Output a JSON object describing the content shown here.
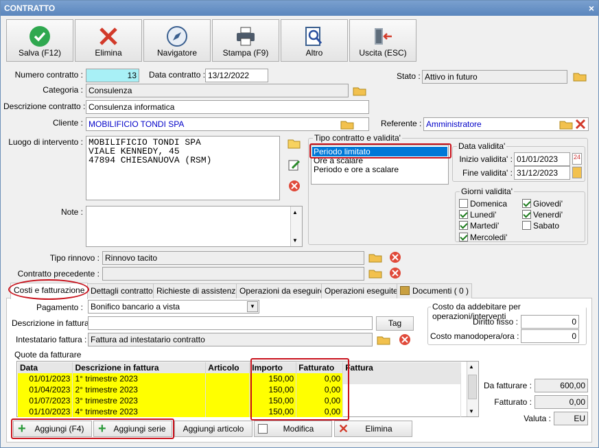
{
  "window": {
    "title": "CONTRATTO",
    "close": "×"
  },
  "toolbar": {
    "save": "Salva (F12)",
    "delete": "Elimina",
    "navigator": "Navigatore",
    "print": "Stampa (F9)",
    "other": "Altro",
    "exit": "Uscita (ESC)"
  },
  "form": {
    "numero_label": "Numero contratto :",
    "numero": "13",
    "data_label": "Data contratto :",
    "data": "13/12/2022",
    "stato_label": "Stato :",
    "stato": "Attivo in futuro",
    "categoria_label": "Categoria :",
    "categoria": "Consulenza",
    "descrizione_label": "Descrizione contratto :",
    "descrizione": "Consulenza informatica",
    "cliente_label": "Cliente :",
    "cliente": "MOBILIFICIO TONDI SPA",
    "referente_label": "Referente :",
    "referente": "Amministratore",
    "luogo_label": "Luogo di intervento :",
    "luogo_lines": [
      "MOBILIFICIO TONDI SPA",
      "VIALE KENNEDY, 45",
      "47894 CHIESANUOVA (RSM)"
    ],
    "note_label": "Note :",
    "note": "",
    "tipo_rinnovo_label": "Tipo rinnovo :",
    "tipo_rinnovo": "Rinnovo tacito",
    "precedente_label": "Contratto precedente :",
    "precedente": ""
  },
  "tipo_contratto": {
    "title": "Tipo contratto e validita'",
    "options": [
      "Periodo limitato",
      "Ore a scalare",
      "Periodo e ore a scalare"
    ],
    "selected": "Periodo limitato"
  },
  "data_validita": {
    "title": "Data validita'",
    "inizio_label": "Inizio validita' :",
    "inizio": "01/01/2023",
    "fine_label": "Fine validita' :",
    "fine": "31/12/2023"
  },
  "giorni": {
    "title": "Giorni validita'",
    "domenica": "Domenica",
    "lunedi": "Lunedi'",
    "martedi": "Martedi'",
    "mercoledi": "Mercoledi'",
    "giovedi": "Giovedi'",
    "venerdi": "Venerdi'",
    "sabato": "Sabato"
  },
  "tabs": {
    "t1": "Costi e fatturazione",
    "t2": "Dettagli contratto",
    "t3": "Richieste di assistenza",
    "t4": "Operazioni da eseguire",
    "t5": "Operazioni eseguite",
    "t6": "Documenti ( 0 )"
  },
  "billing": {
    "pagamento_label": "Pagamento :",
    "pagamento": "Bonifico bancario a vista",
    "desc_fattura_label": "Descrizione in fattura",
    "desc_fattura": "",
    "tag": "Tag",
    "intestatario_label": "Intestatario fattura :",
    "intestatario": "Fattura ad intestatario contratto",
    "quote_label": "Quote da fatturare"
  },
  "costo": {
    "title": "Costo da addebitare per operazioni/interventi",
    "diritto_label": "Diritto fisso :",
    "diritto": "0",
    "manodopera_label": "Costo manodopera/ora :",
    "manodopera": "0"
  },
  "grid": {
    "headers": {
      "data": "Data",
      "descrizione": "Descrizione in fattura",
      "articolo": "Articolo",
      "importo": "Importo",
      "fatturato": "Fatturato",
      "fattura": "Fattura"
    },
    "rows": [
      {
        "data": "01/01/2023",
        "descrizione": "1° trimestre 2023",
        "articolo": "",
        "importo": "150,00",
        "fatturato": "0,00",
        "fattura": ""
      },
      {
        "data": "01/04/2023",
        "descrizione": "2° trimestre 2023",
        "articolo": "",
        "importo": "150,00",
        "fatturato": "0,00",
        "fattura": ""
      },
      {
        "data": "01/07/2023",
        "descrizione": "3° trimestre 2023",
        "articolo": "",
        "importo": "150,00",
        "fatturato": "0,00",
        "fattura": ""
      },
      {
        "data": "01/10/2023",
        "descrizione": "4° trimestre 2023",
        "articolo": "",
        "importo": "150,00",
        "fatturato": "0,00",
        "fattura": ""
      }
    ]
  },
  "totals": {
    "da_fatturare_label": "Da fatturare :",
    "da_fatturare": "600,00",
    "fatturato_label": "Fatturato :",
    "fatturato": "0,00",
    "valuta_label": "Valuta :",
    "valuta": "EU"
  },
  "bottom": {
    "aggiungi": "Aggiungi (F4)",
    "aggiungi_serie": "Aggiungi serie",
    "aggiungi_articolo": "Aggiungi articolo",
    "modifica": "Modifica",
    "elimina": "Elimina"
  },
  "colors": {
    "highlight": "#ffff00",
    "accent_red": "#c8101a",
    "selection": "#0078d7"
  }
}
